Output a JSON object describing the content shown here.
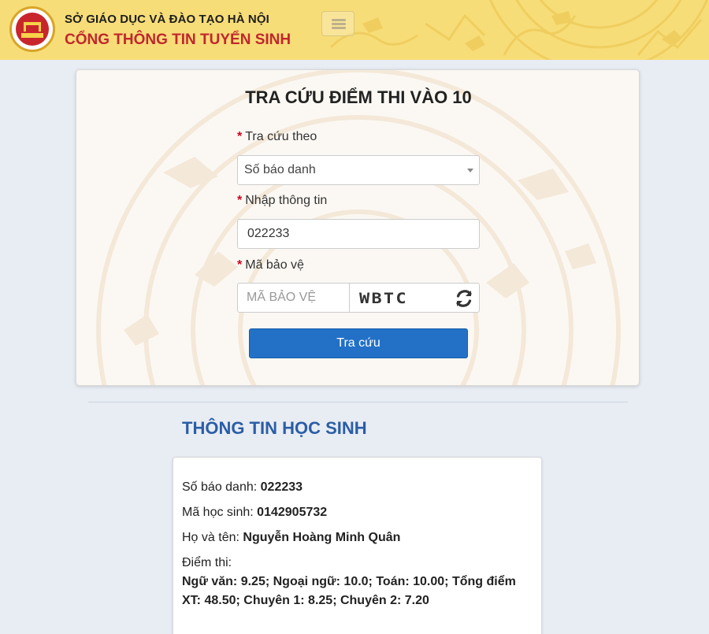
{
  "header": {
    "dept": "SỞ GIÁO DỤC VÀ ĐÀO TẠO HÀ NỘI",
    "portal": "CỔNG THÔNG TIN TUYỂN SINH",
    "brand_color": "#c0272d",
    "menu_icon": "hamburger-icon"
  },
  "search": {
    "title": "TRA CỨU ĐIỂM THI VÀO 10",
    "lookup_label": "Tra cứu theo",
    "lookup_value": "Số báo danh",
    "info_label": "Nhập thông tin",
    "info_value": "022233",
    "captcha_label": "Mã bảo vệ",
    "captcha_placeholder": "MÃ BẢO VỆ",
    "captcha_text": "WBTC",
    "refresh_icon": "refresh-icon",
    "submit_label": "Tra cứu",
    "accent_color": "#2271c7"
  },
  "student": {
    "section_title": "THÔNG TIN HỌC SINH",
    "sbd_label": "Số báo danh:",
    "sbd_value": "022233",
    "mhs_label": "Mã học sinh:",
    "mhs_value": "0142905732",
    "name_label": "Họ và tên:",
    "name_value": "Nguyễn Hoàng Minh Quân",
    "scores_label": "Điểm thi:",
    "scores_value": "Ngữ văn: 9.25; Ngoại ngữ: 10.0; Toán: 10.00; Tổng điểm XT: 48.50; Chuyên 1: 8.25; Chuyên 2: 7.20"
  }
}
